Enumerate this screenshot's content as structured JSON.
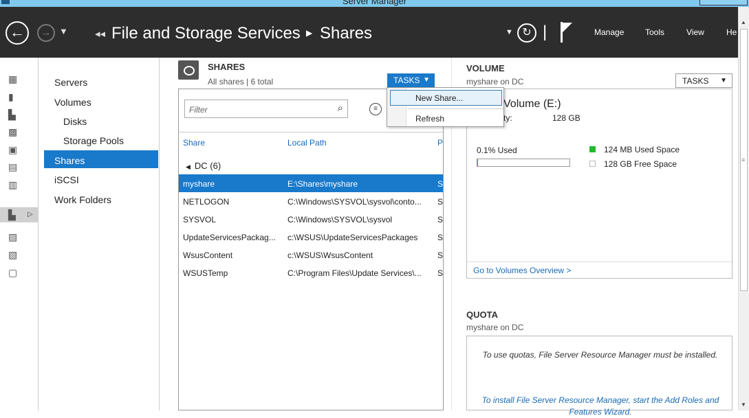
{
  "window": {
    "title": "Server Manager"
  },
  "header": {
    "breadcrumb_root": "File and Storage Services",
    "breadcrumb_current": "Shares",
    "menu": [
      "Manage",
      "Tools",
      "View",
      "He"
    ]
  },
  "left_nav": {
    "items": [
      {
        "label": "Servers"
      },
      {
        "label": "Volumes"
      },
      {
        "label": "Disks"
      },
      {
        "label": "Storage Pools"
      },
      {
        "label": "Shares"
      },
      {
        "label": "iSCSI"
      },
      {
        "label": "Work Folders"
      }
    ],
    "selected": "Shares"
  },
  "icon_bar": [
    "dashboard-icon",
    "local-server-icon",
    "all-servers-icon",
    "ad-ds-icon",
    "ad-cs-icon",
    "dhcp-icon",
    "dns-icon",
    "file-storage-icon",
    "iis-icon",
    "wsus-icon",
    "remote-desktop-icon"
  ],
  "shares": {
    "title": "SHARES",
    "subtitle": "All shares | 6 total",
    "tasks_label": "TASKS",
    "filter_placeholder": "Filter",
    "columns": [
      "Share",
      "Local Path",
      "P"
    ],
    "group_label": "DC (6)",
    "rows": [
      {
        "share": "myshare",
        "path": "E:\\Shares\\myshare",
        "p": "S"
      },
      {
        "share": "NETLOGON",
        "path": "C:\\Windows\\SYSVOL\\sysvol\\conto...",
        "p": "S"
      },
      {
        "share": "SYSVOL",
        "path": "C:\\Windows\\SYSVOL\\sysvol",
        "p": "S"
      },
      {
        "share": "UpdateServicesPackag...",
        "path": "c:\\WSUS\\UpdateServicesPackages",
        "p": "S"
      },
      {
        "share": "WsusContent",
        "path": "c:\\WSUS\\WsusContent",
        "p": "S"
      },
      {
        "share": "WSUSTemp",
        "path": "C:\\Program Files\\Update Services\\...",
        "p": "S"
      }
    ],
    "selected_row": 0
  },
  "context_menu": {
    "items": [
      "New Share...",
      "Refresh"
    ],
    "highlighted": "New Share..."
  },
  "volume": {
    "title": "VOLUME",
    "subtitle": "myshare on DC",
    "tasks_label": "TASKS",
    "name": "Volume (E:)",
    "capacity_label": "ty:",
    "capacity_value": "128 GB",
    "used_pct_label": "0.1% Used",
    "used_fraction": 0.001,
    "legend": [
      {
        "label": "124 MB Used Space",
        "color": "#25b82d"
      },
      {
        "label": "128 GB Free Space",
        "color": "#ffffff"
      }
    ],
    "link": "Go to Volumes Overview >"
  },
  "quota": {
    "title": "QUOTA",
    "subtitle": "myshare on DC",
    "message": "To use quotas, File Server Resource Manager must be installed.",
    "link": "To install File Server Resource Manager, start the Add Roles and Features Wizard."
  },
  "colors": {
    "accent": "#1979ca",
    "header_bg": "#2d2d2d",
    "used": "#25b82d"
  }
}
